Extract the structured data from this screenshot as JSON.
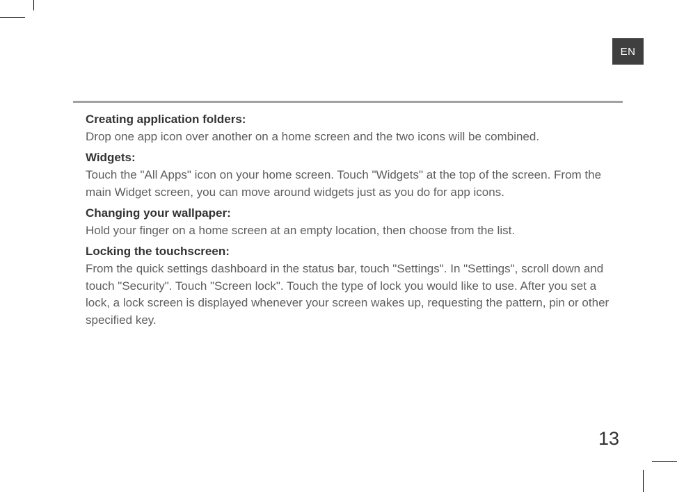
{
  "lang": "EN",
  "sections": [
    {
      "heading": "Creating application folders:",
      "body": "Drop one app icon over another on a home screen and the two icons will be combined."
    },
    {
      "heading": "Widgets:",
      "body": "Touch the \"All Apps\" icon on your home screen. Touch \"Widgets\" at the top of the screen. From the main Widget screen, you can move around widgets just as you do for app icons."
    },
    {
      "heading": "Changing your wallpaper:",
      "body": "Hold your finger on a home screen at an empty location, then choose from the list."
    },
    {
      "heading": "Locking the touchscreen:",
      "body": "From the quick settings dashboard in the status bar, touch \"Settings\". In \"Settings\", scroll down and touch \"Security\". Touch \"Screen lock\". Touch the type of lock you would like to use. After you set a lock, a lock screen is displayed whenever your screen wakes up, requesting the pattern, pin or other specified key."
    }
  ],
  "pageNumber": "13"
}
